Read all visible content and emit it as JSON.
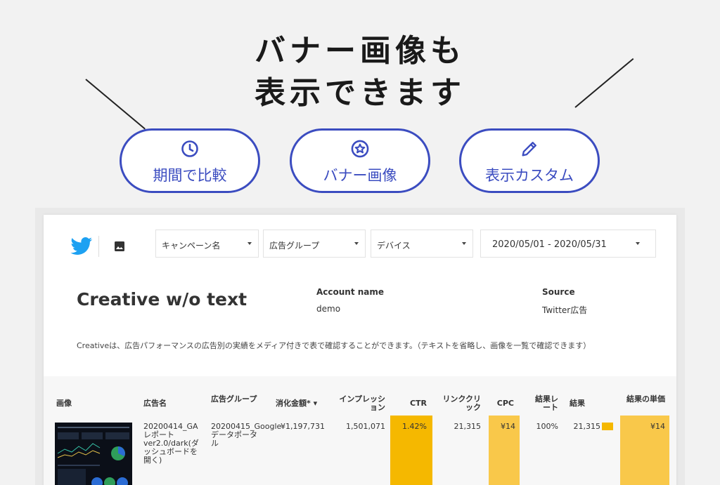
{
  "headline": {
    "line1": "バナー画像も",
    "line2": "表示できます"
  },
  "features": [
    {
      "label": "期間で比較",
      "icon": "clock-icon"
    },
    {
      "label": "バナー画像",
      "icon": "star-badge-icon"
    },
    {
      "label": "表示カスタム",
      "icon": "pencil-icon"
    }
  ],
  "colors": {
    "accent": "#3b4cc0",
    "highlight_dark": "#f5b800",
    "highlight_light": "#f9c84a",
    "twitter": "#1da1f2"
  },
  "filters": {
    "campaign": "キャンペーン名",
    "ad_group": "広告グループ",
    "device": "デバイス",
    "date_range": "2020/05/01 - 2020/05/31"
  },
  "report": {
    "title": "Creative w/o text",
    "account_label": "Account name",
    "account_value": "demo",
    "source_label": "Source",
    "source_value": "Twitter広告",
    "description": "Creativeは、広告パフォーマンスの広告別の実績をメディア付きで表で確認することができます。（テキストを省略し、画像を一覧で確認できます）"
  },
  "table": {
    "headers": {
      "image": "画像",
      "ad_name": "広告名",
      "ad_group": "広告グループ",
      "spend": "消化金額* ▾",
      "impressions": "インプレッション",
      "ctr": "CTR",
      "link_clicks": "リンククリック",
      "cpc": "CPC",
      "result_rate": "結果レート",
      "results": "結果",
      "cost_per_result": "結果の単価"
    },
    "rows": [
      {
        "ad_name": "20200414_GAレポートver2.0/dark(ダッシュボードを開く)",
        "ad_group": "20200415_Googleデータポータル",
        "spend": "¥1,197,731",
        "impressions": "1,501,071",
        "ctr": "1.42%",
        "link_clicks": "21,315",
        "cpc": "¥14",
        "result_rate": "100%",
        "results": "21,315",
        "cost_per_result": "¥14"
      }
    ]
  }
}
